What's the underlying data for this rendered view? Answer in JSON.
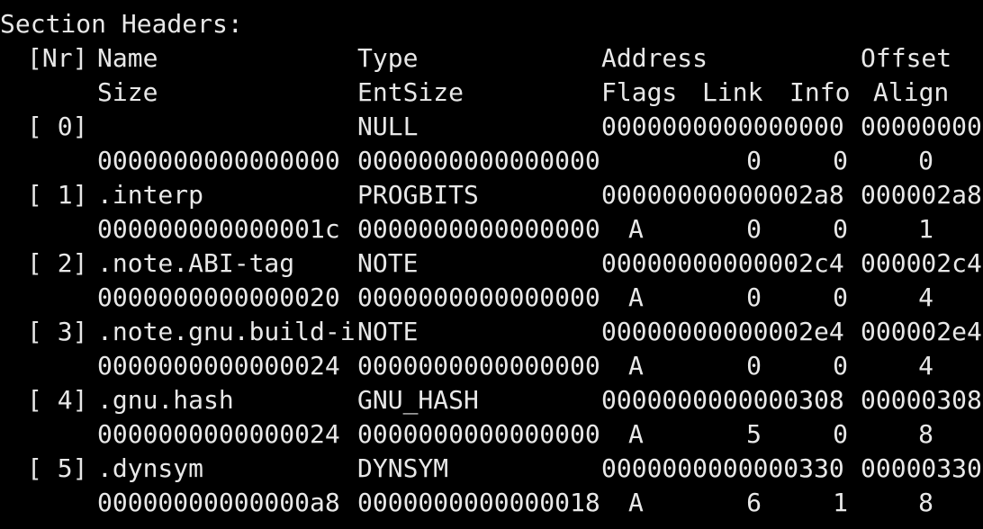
{
  "theme": {
    "background": "#000000",
    "foreground": "#e8e8e8"
  },
  "heading": "Section Headers:",
  "header1": {
    "nr": "[Nr]",
    "name": "Name",
    "type": "Type",
    "address": "Address",
    "offset": "Offset"
  },
  "header2": {
    "size": "Size",
    "entsize": "EntSize",
    "flags": "Flags",
    "link": "Link",
    "info": "Info",
    "align": "Align"
  },
  "sections": [
    {
      "nr": "[ 0]",
      "name": "",
      "type": "NULL",
      "address": "0000000000000000",
      "offset": "00000000",
      "size": "0000000000000000",
      "entsize": "0000000000000000",
      "flags": "",
      "link": "0",
      "info": "0",
      "align": "0"
    },
    {
      "nr": "[ 1]",
      "name": ".interp",
      "type": "PROGBITS",
      "address": "00000000000002a8",
      "offset": "000002a8",
      "size": "000000000000001c",
      "entsize": "0000000000000000",
      "flags": "A",
      "link": "0",
      "info": "0",
      "align": "1"
    },
    {
      "nr": "[ 2]",
      "name": ".note.ABI-tag",
      "type": "NOTE",
      "address": "00000000000002c4",
      "offset": "000002c4",
      "size": "0000000000000020",
      "entsize": "0000000000000000",
      "flags": "A",
      "link": "0",
      "info": "0",
      "align": "4"
    },
    {
      "nr": "[ 3]",
      "name": ".note.gnu.build-i",
      "type": "NOTE",
      "address": "00000000000002e4",
      "offset": "000002e4",
      "size": "0000000000000024",
      "entsize": "0000000000000000",
      "flags": "A",
      "link": "0",
      "info": "0",
      "align": "4"
    },
    {
      "nr": "[ 4]",
      "name": ".gnu.hash",
      "type": "GNU_HASH",
      "address": "0000000000000308",
      "offset": "00000308",
      "size": "0000000000000024",
      "entsize": "0000000000000000",
      "flags": "A",
      "link": "5",
      "info": "0",
      "align": "8"
    },
    {
      "nr": "[ 5]",
      "name": ".dynsym",
      "type": "DYNSYM",
      "address": "0000000000000330",
      "offset": "00000330",
      "size": "00000000000000a8",
      "entsize": "0000000000000018",
      "flags": "A",
      "link": "6",
      "info": "1",
      "align": "8"
    }
  ]
}
